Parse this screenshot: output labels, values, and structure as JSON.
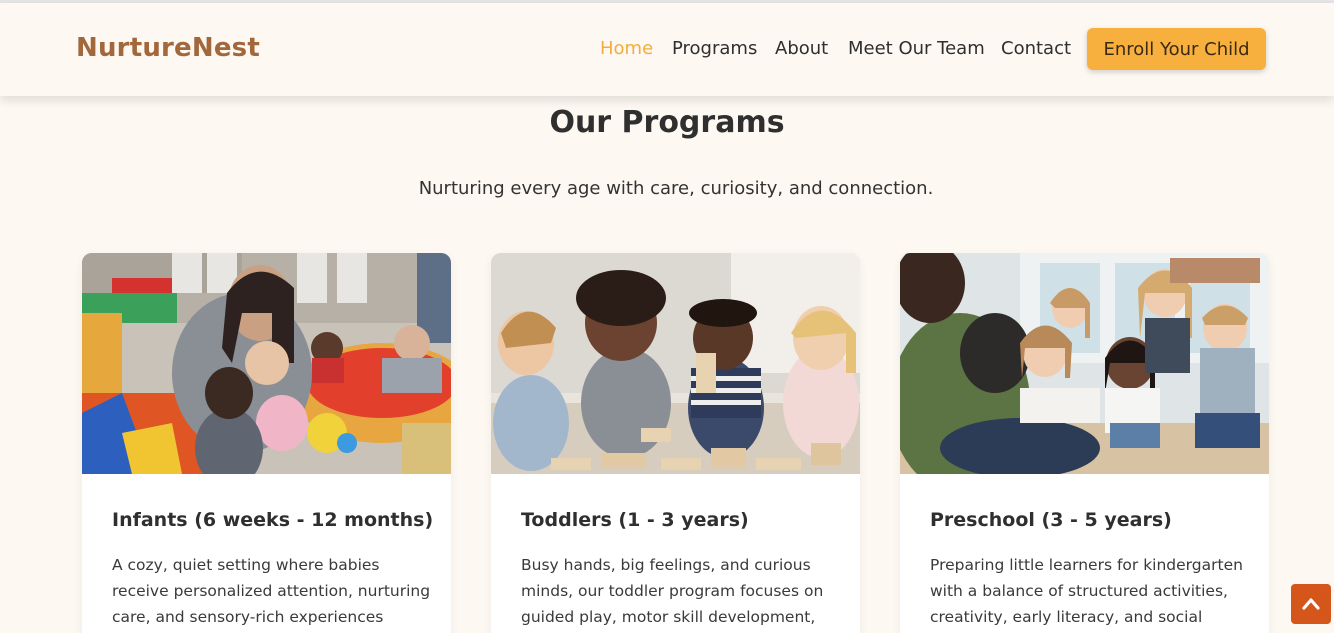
{
  "brand": {
    "name": "NurtureNest"
  },
  "nav": {
    "items": [
      {
        "label": "Home",
        "active": true
      },
      {
        "label": "Programs"
      },
      {
        "label": "About"
      },
      {
        "label": "Meet Our Team"
      },
      {
        "label": "Contact"
      }
    ],
    "cta_label": "Enroll Your Child"
  },
  "programs": {
    "title": "Our Programs",
    "subtitle": "Nurturing every age with care, curiosity, and connection.",
    "cards": [
      {
        "title": "Infants (6 weeks - 12 months)",
        "text": "A cozy, quiet setting where babies receive personalized attention, nurturing care, and sensory-rich experiences throughout the"
      },
      {
        "title": "Toddlers (1 - 3 years)",
        "text": "Busy hands, big feelings, and curious minds, our toddler program focuses on guided play, motor skill development, and"
      },
      {
        "title": "Preschool (3 - 5 years)",
        "text": "Preparing little learners for kindergarten with a balance of structured activities, creativity, early literacy, and social"
      }
    ]
  },
  "colors": {
    "accent": "#f7b03e",
    "brand": "#a2673b",
    "background": "#fdf8f2",
    "scroll_button": "#d4561a"
  },
  "icons": {
    "scroll_top": "chevron-up-icon"
  }
}
